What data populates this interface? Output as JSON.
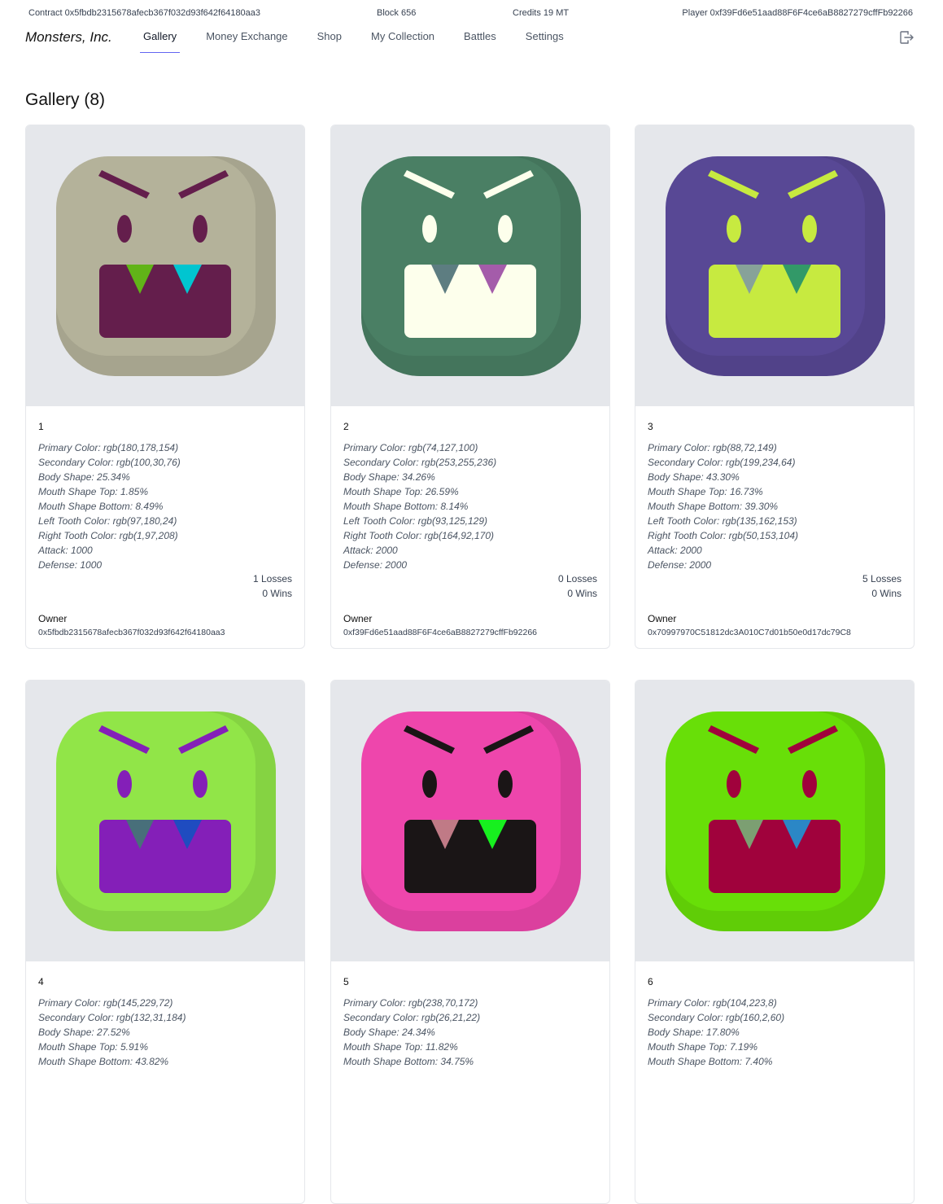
{
  "status_bar": {
    "contract": "Contract 0x5fbdb2315678afecb367f032d93f642f64180aa3",
    "block": "Block 656",
    "credits": "Credits 19 MT",
    "player": "Player 0xf39Fd6e51aad88F6F4ce6aB8827279cffFb92266"
  },
  "nav": {
    "brand": "Monsters, Inc.",
    "links": [
      "Gallery",
      "Money Exchange",
      "Shop",
      "My Collection",
      "Battles",
      "Settings"
    ],
    "active": "Gallery",
    "logout_icon": "logout-icon"
  },
  "page": {
    "title": "Gallery (8)"
  },
  "labels": {
    "owner": "Owner"
  },
  "cards": [
    {
      "id": "1",
      "colors": {
        "primary": "#b4b29a",
        "secondary": "#641e4c",
        "left_tooth": "#61b418",
        "right_tooth": "#01c5d0"
      },
      "attributes": [
        "Primary Color: rgb(180,178,154)",
        "Secondary Color: rgb(100,30,76)",
        "Body Shape: 25.34%",
        "Mouth Shape Top: 1.85%",
        "Mouth Shape Bottom: 8.49%",
        "Left Tooth Color: rgb(97,180,24)",
        "Right Tooth Color: rgb(1,97,208)",
        "Attack: 1000",
        "Defense: 1000"
      ],
      "losses": "1 Losses",
      "wins": "0 Wins",
      "owner": "0x5fbdb2315678afecb367f032d93f642f64180aa3"
    },
    {
      "id": "2",
      "colors": {
        "primary": "#4a7f64",
        "secondary": "#fdffec",
        "left_tooth": "#5d7d81",
        "right_tooth": "#a45caa"
      },
      "attributes": [
        "Primary Color: rgb(74,127,100)",
        "Secondary Color: rgb(253,255,236)",
        "Body Shape: 34.26%",
        "Mouth Shape Top: 26.59%",
        "Mouth Shape Bottom: 8.14%",
        "Left Tooth Color: rgb(93,125,129)",
        "Right Tooth Color: rgb(164,92,170)",
        "Attack: 2000",
        "Defense: 2000"
      ],
      "losses": "0 Losses",
      "wins": "0 Wins",
      "owner": "0xf39Fd6e51aad88F6F4ce6aB8827279cffFb92266"
    },
    {
      "id": "3",
      "colors": {
        "primary": "#584895",
        "secondary": "#c7ea40",
        "left_tooth": "#87a299",
        "right_tooth": "#329968"
      },
      "attributes": [
        "Primary Color: rgb(88,72,149)",
        "Secondary Color: rgb(199,234,64)",
        "Body Shape: 43.30%",
        "Mouth Shape Top: 16.73%",
        "Mouth Shape Bottom: 39.30%",
        "Left Tooth Color: rgb(135,162,153)",
        "Right Tooth Color: rgb(50,153,104)",
        "Attack: 2000",
        "Defense: 2000"
      ],
      "losses": "5 Losses",
      "wins": "0 Wins",
      "owner": "0x70997970C51812dc3A010C7d01b50e0d17dc79C8"
    },
    {
      "id": "4",
      "colors": {
        "primary": "#91e548",
        "secondary": "#841fb8",
        "left_tooth": "#486f7a",
        "right_tooth": "#1f4cc0"
      },
      "attributes": [
        "Primary Color: rgb(145,229,72)",
        "Secondary Color: rgb(132,31,184)",
        "Body Shape: 27.52%",
        "Mouth Shape Top: 5.91%",
        "Mouth Shape Bottom: 43.82%"
      ],
      "losses": "",
      "wins": "",
      "owner": ""
    },
    {
      "id": "5",
      "colors": {
        "primary": "#ee46ac",
        "secondary": "#1a1516",
        "left_tooth": "#c07a86",
        "right_tooth": "#17f01f"
      },
      "attributes": [
        "Primary Color: rgb(238,70,172)",
        "Secondary Color: rgb(26,21,22)",
        "Body Shape: 24.34%",
        "Mouth Shape Top: 11.82%",
        "Mouth Shape Bottom: 34.75%"
      ],
      "losses": "",
      "wins": "",
      "owner": ""
    },
    {
      "id": "6",
      "colors": {
        "primary": "#68df08",
        "secondary": "#a0023c",
        "left_tooth": "#7c9f72",
        "right_tooth": "#2b87c6"
      },
      "attributes": [
        "Primary Color: rgb(104,223,8)",
        "Secondary Color: rgb(160,2,60)",
        "Body Shape: 17.80%",
        "Mouth Shape Top: 7.19%",
        "Mouth Shape Bottom: 7.40%"
      ],
      "losses": "",
      "wins": "",
      "owner": ""
    }
  ]
}
